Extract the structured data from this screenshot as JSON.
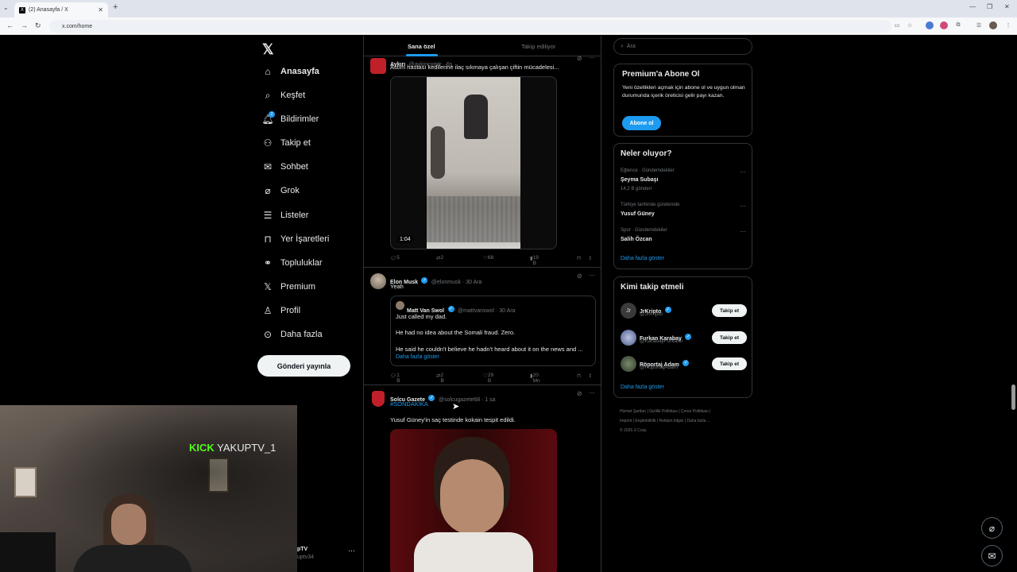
{
  "browser": {
    "tab_title": "(2) Anasayfa / X",
    "url": "x.com/home"
  },
  "nav": {
    "items": [
      {
        "label": "Anasayfa",
        "icon": "home-icon"
      },
      {
        "label": "Keşfet",
        "icon": "search-icon"
      },
      {
        "label": "Bildirimler",
        "icon": "bell-icon"
      },
      {
        "label": "Takip et",
        "icon": "person-plus-icon"
      },
      {
        "label": "Sohbet",
        "icon": "mail-icon"
      },
      {
        "label": "Grok",
        "icon": "grok-icon"
      },
      {
        "label": "Listeler",
        "icon": "list-icon"
      },
      {
        "label": "Yer İşaretleri",
        "icon": "bookmark-icon"
      },
      {
        "label": "Topluluklar",
        "icon": "people-icon"
      },
      {
        "label": "Premium",
        "icon": "x-icon"
      },
      {
        "label": "Profil",
        "icon": "person-icon"
      },
      {
        "label": "Daha fazla",
        "icon": "more-circle-icon"
      }
    ],
    "notification_badge": "2",
    "post_button": "Gönderi yayınla"
  },
  "timeline": {
    "tabs": [
      "Sana özel",
      "Takip ediliyor"
    ],
    "tweet1": {
      "name": "Aykırı",
      "handle": "@aykiricomtr · 6s",
      "text": "Astım hastası kedilerine ilaç sıkmaya çalışan çiftin mücadelesi...",
      "video_duration": "1:04",
      "replies": "5",
      "reposts": "2",
      "likes": "68",
      "views": "19 B"
    },
    "tweet2": {
      "name": "Elon Musk",
      "handle": "@elonmusk · 30 Ara",
      "text": "Yeah",
      "quote_name": "Matt Van Swol",
      "quote_handle": "@mattvanswol · 30 Ara",
      "quote_line1": "Just called my dad.",
      "quote_line2": "He had no idea about the Somali fraud. Zero.",
      "quote_line3": "He said he couldn't believe he hadn't heard about it on the news and ...",
      "quote_more": "Daha fazla göster",
      "replies": "1 B",
      "reposts": "2 B",
      "likes": "29 B",
      "views": "20 Mn"
    },
    "tweet3": {
      "name": "Solcu Gazete",
      "handle": "@solcugazete68 · 1 sa",
      "hashtag": "#SONDAKİKA",
      "text": "Yusuf Güney'in saç testinde kokain tespit edildi."
    }
  },
  "sidebar": {
    "search_placeholder": "Ara",
    "premium": {
      "title": "Premium'a Abone Ol",
      "body": "Yeni özellikleri açmak için abone ol ve uygun olman durumunda içerik üreticisi gelir payı kazan.",
      "button": "Abone ol"
    },
    "trends": {
      "title": "Neler oluyor?",
      "items": [
        {
          "context": "Eğlence · Gündemdekiler",
          "name": "Şeyma Subaşı",
          "count": "14,2 B gönderi"
        },
        {
          "context": "Türkiye tarihinde gündemde",
          "name": "Yusuf Güney",
          "count": ""
        },
        {
          "context": "Spor · Gündemdekiler",
          "name": "Salih Özcan",
          "count": ""
        }
      ],
      "show_more": "Daha fazla göster"
    },
    "who_to_follow": {
      "title": "Kimi takip etmeli",
      "items": [
        {
          "name": "JrKripto",
          "handle": "@JrKripto",
          "button": "Takip et"
        },
        {
          "name": "Furkan Karabay",
          "handle": "@KarabayFurkann",
          "button": "Takip et"
        },
        {
          "name": "Röportaj Adam",
          "handle": "@RoportajAdam",
          "button": "Takip et"
        }
      ],
      "show_more": "Daha fazla göster"
    },
    "footer": {
      "line1": "Hizmet Şartları  |  Gizlilik Politikası  |  Çerez Politikası  |",
      "line2": "Imprint  |  Erişilebilirlik  |  Reklam bilgisi  |  Daha fazla ...",
      "line3": "© 2025 X Corp."
    }
  },
  "overlay": {
    "kick_logo": "KICK",
    "streamer": "YAKUPTV_1",
    "account_name": "pTV",
    "account_handle": "uptv34"
  },
  "colors": {
    "accent": "#1d9bf0",
    "kick_green": "#53fc18",
    "background": "#000000"
  }
}
